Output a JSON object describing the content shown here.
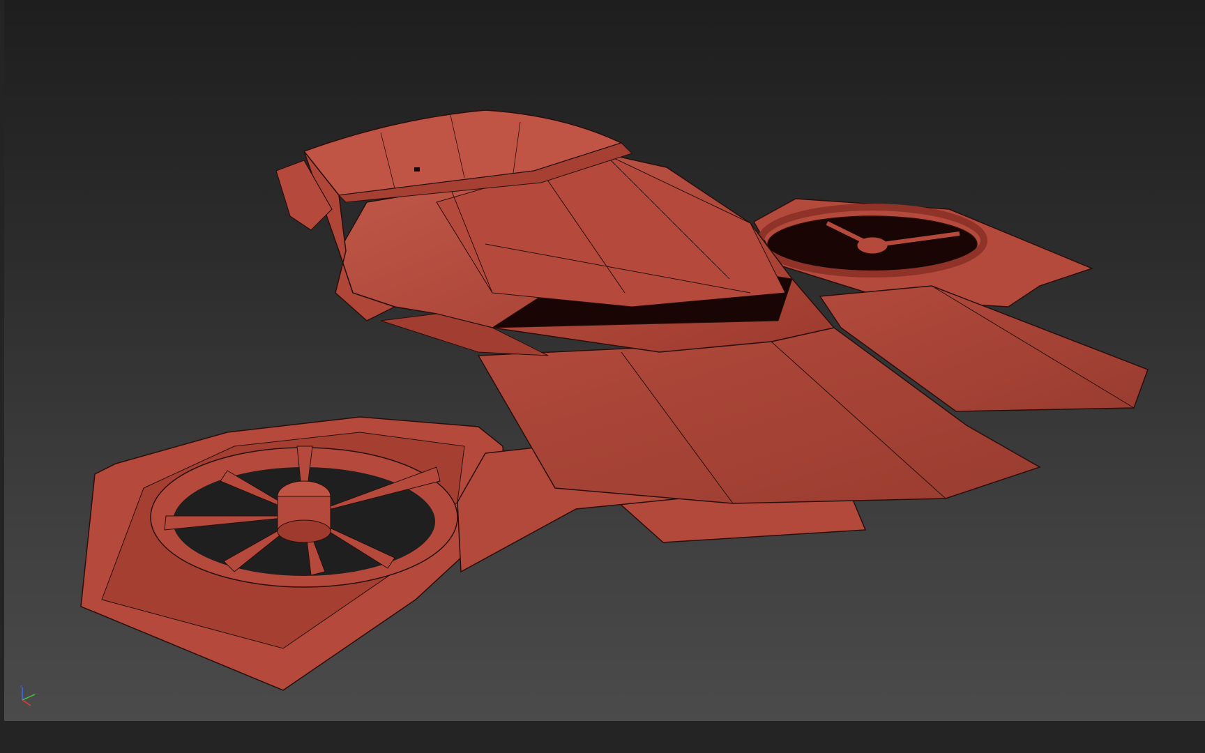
{
  "viewport": {
    "background_top": "#1e1e1e",
    "background_bottom": "#4b4b4b"
  },
  "model": {
    "material_color": "#b54a3c",
    "shadow_color": "#8f3329",
    "highlight_color": "#c25a4a",
    "wire_color": "#2a0e0b",
    "dark_interior": "#1a0505"
  },
  "gizmo": {
    "x_color": "#e23a3a",
    "y_color": "#3ccf3c",
    "z_color": "#3a6cff",
    "icon": "axis-tripod-icon"
  }
}
